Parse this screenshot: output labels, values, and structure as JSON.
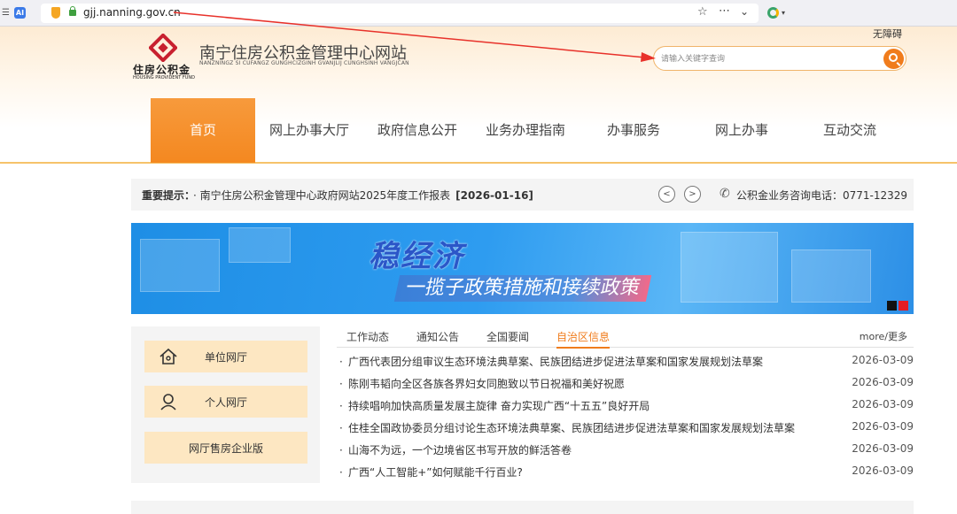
{
  "browser": {
    "url": "gjj.nanning.gov.cn",
    "tab_icon_label": "AI"
  },
  "header": {
    "accessible_label": "无障碍",
    "logo_cn": "住房公积金",
    "logo_en": "HOUSING PROVIDENT FUND",
    "site_title": "南宁住房公积金管理中心网站",
    "site_title_pinyin": "NANZNINGZ SI CUFANGZ GUNGHCIZGINH GVANJLIJ CUNGHSINH VANGJCAN",
    "search_placeholder": "请输入关键字查询"
  },
  "nav": {
    "items": [
      {
        "label": "首页",
        "active": true
      },
      {
        "label": "网上办事大厅"
      },
      {
        "label": "政府信息公开"
      },
      {
        "label": "业务办理指南"
      },
      {
        "label": "办事服务"
      },
      {
        "label": "网上办事"
      },
      {
        "label": "互动交流"
      }
    ]
  },
  "notice": {
    "label": "重要提示：",
    "text": "· 南宁住房公积金管理中心政府网站2025年度工作报表",
    "date": "[2026-01-16]",
    "hotline": "公积金业务咨询电话：0771-12329"
  },
  "banner": {
    "title": "稳经济",
    "subtitle": "一揽子政策措施和接续政策"
  },
  "sidebar": {
    "items": [
      {
        "label": "单位网厅",
        "icon": "home-icon"
      },
      {
        "label": "个人网厅",
        "icon": "person-icon"
      },
      {
        "label": "网厅售房企业版",
        "icon": ""
      }
    ]
  },
  "news": {
    "tabs": [
      {
        "label": "工作动态"
      },
      {
        "label": "通知公告"
      },
      {
        "label": "全国要闻"
      },
      {
        "label": "自治区信息",
        "active": true
      }
    ],
    "more_label": "more/更多",
    "items": [
      {
        "title": "广西代表团分组审议生态环境法典草案、民族团结进步促进法草案和国家发展规划法草案",
        "date": "2026-03-09"
      },
      {
        "title": "陈刚韦韬向全区各族各界妇女同胞致以节日祝福和美好祝愿",
        "date": "2026-03-09"
      },
      {
        "title": "持续唱响加快高质量发展主旋律 奋力实现广西“十五五”良好开局",
        "date": "2026-03-09"
      },
      {
        "title": "住桂全国政协委员分组讨论生态环境法典草案、民族团结进步促进法草案和国家发展规划法草案",
        "date": "2026-03-09"
      },
      {
        "title": "山海不为远，一个边境省区书写开放的鲜活答卷",
        "date": "2026-03-09"
      },
      {
        "title": "广西“人工智能+”如何赋能千行百业?",
        "date": "2026-03-09"
      }
    ]
  },
  "colors": {
    "accent": "#f07c1c",
    "nav_active": "#f48820",
    "arrow": "#e8312a"
  }
}
